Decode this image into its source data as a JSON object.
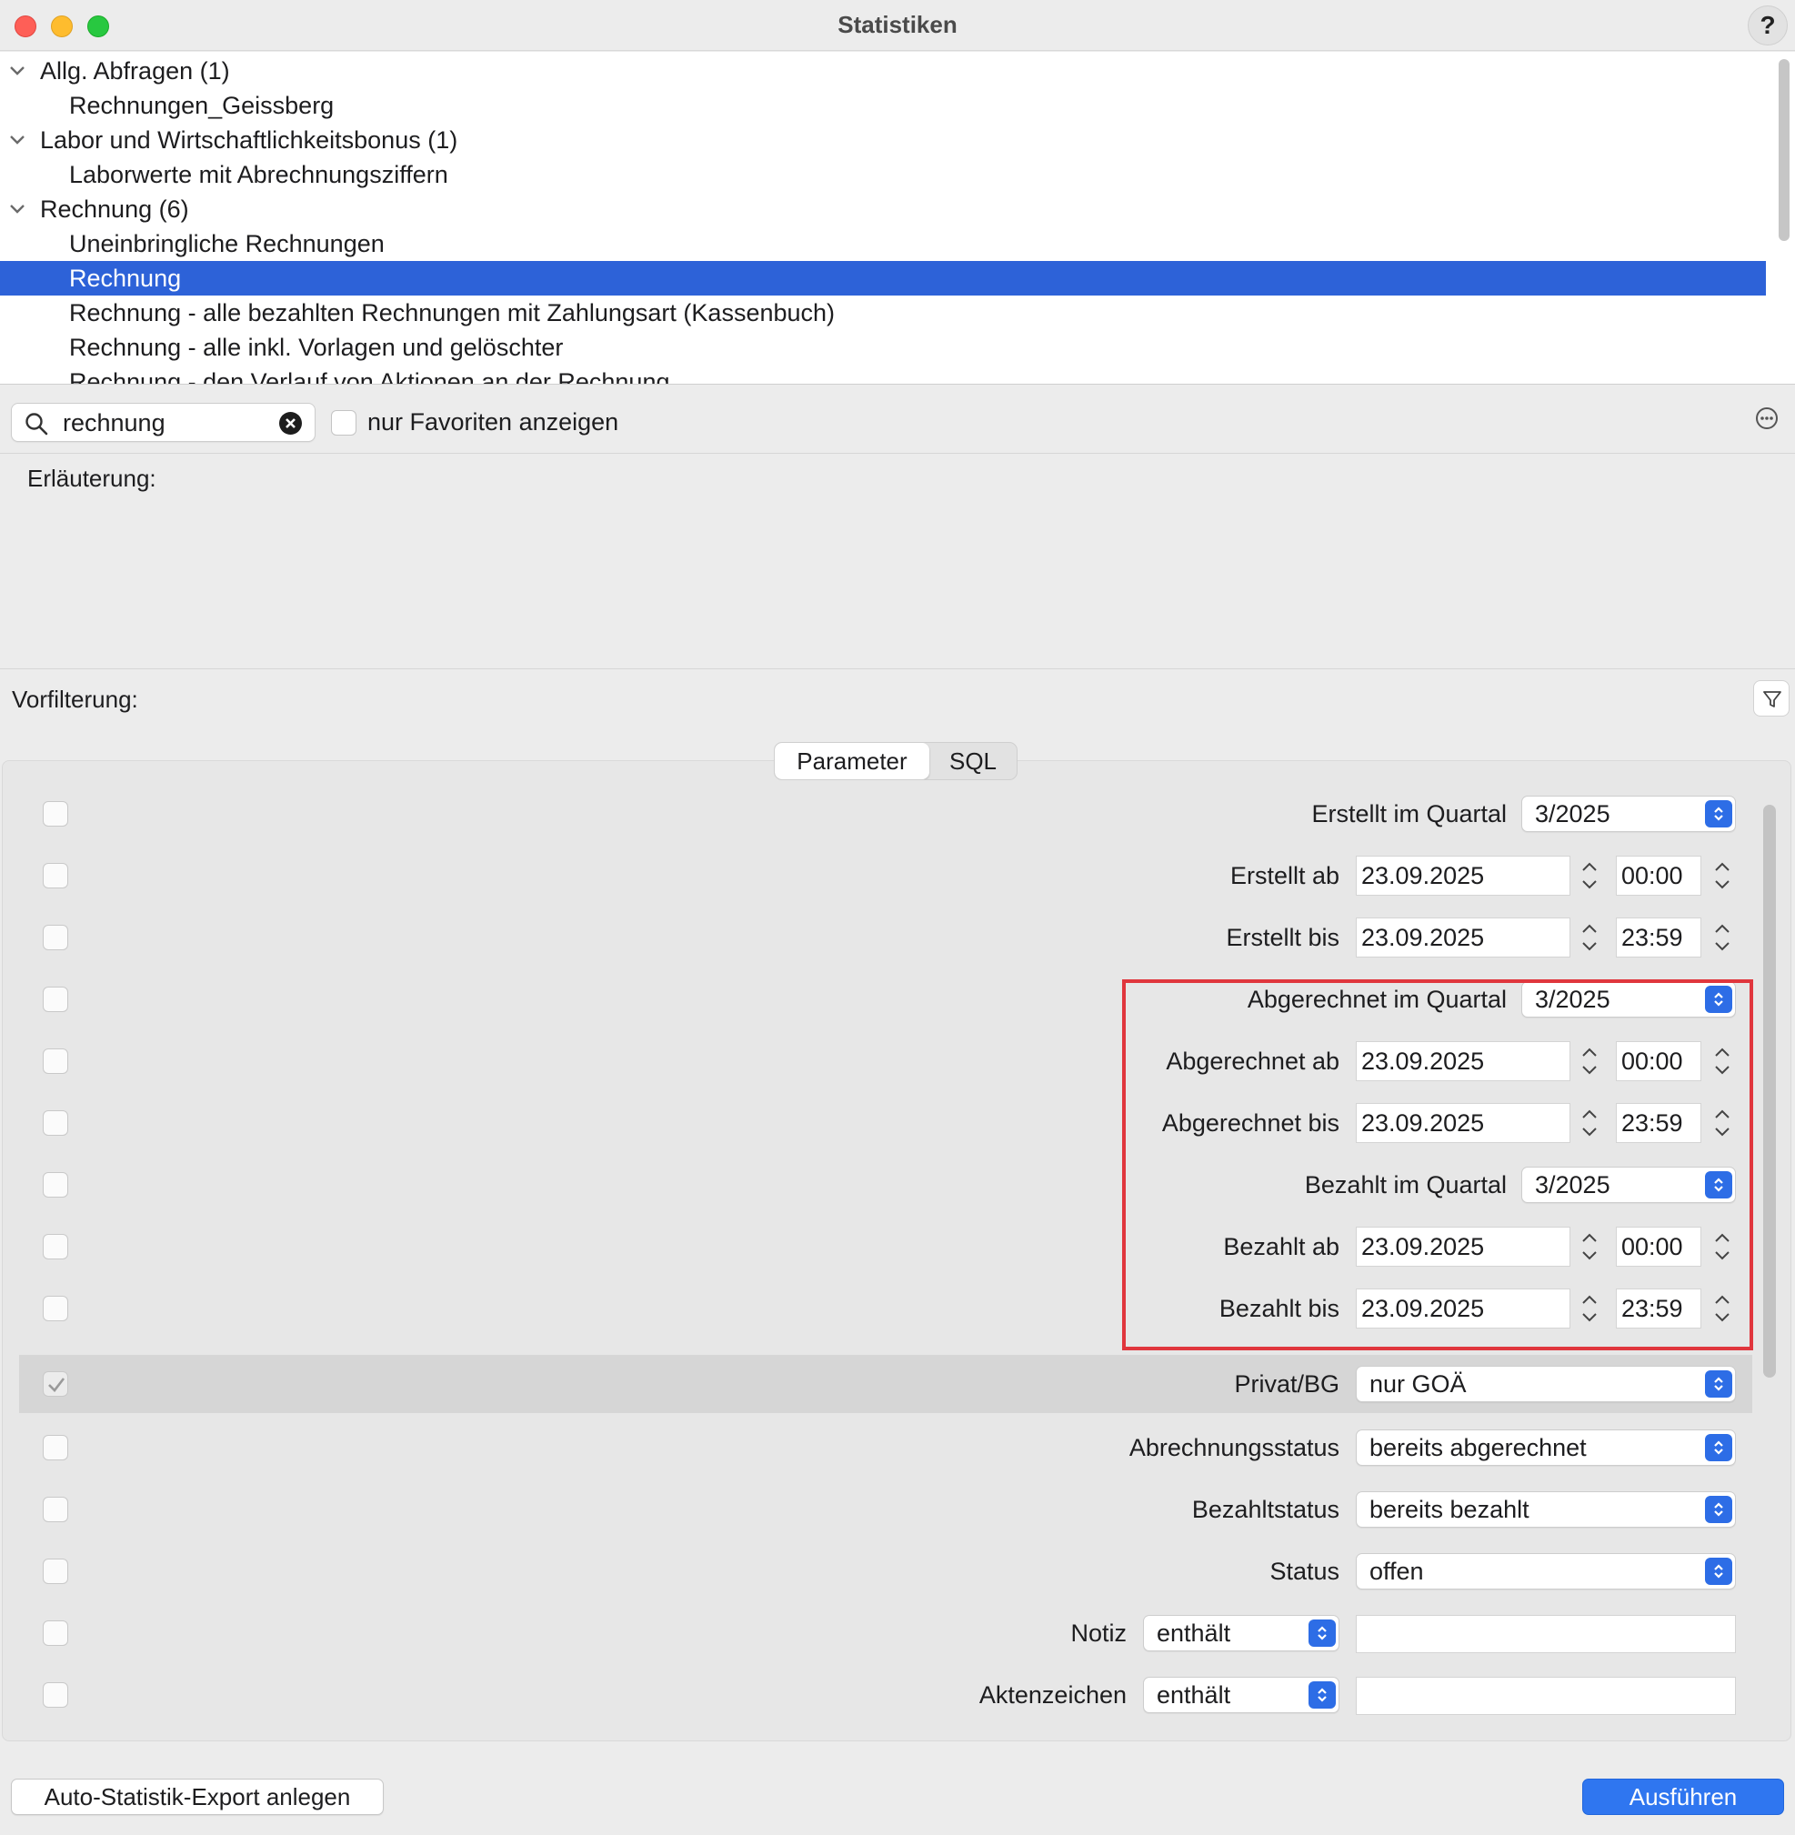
{
  "window": {
    "title": "Statistiken",
    "help_label": "?"
  },
  "tree": [
    {
      "label": "Allg. Abfragen (1)",
      "type": "group"
    },
    {
      "label": "Rechnungen_Geissberg",
      "type": "child"
    },
    {
      "label": "Labor und Wirtschaftlichkeitsbonus (1)",
      "type": "group"
    },
    {
      "label": "Laborwerte mit Abrechnungsziffern",
      "type": "child"
    },
    {
      "label": "Rechnung (6)",
      "type": "group"
    },
    {
      "label": "Uneinbringliche Rechnungen",
      "type": "child"
    },
    {
      "label": "Rechnung",
      "type": "child",
      "selected": true
    },
    {
      "label": "Rechnung - alle bezahlten Rechnungen mit Zahlungsart (Kassenbuch)",
      "type": "child"
    },
    {
      "label": "Rechnung - alle inkl. Vorlagen und gelöschter",
      "type": "child"
    },
    {
      "label": "Rechnung - den Verlauf von Aktionen an der Rechnung",
      "type": "child"
    }
  ],
  "search": {
    "value": "rechnung",
    "favorites_label": "nur Favoriten anzeigen"
  },
  "explanation_label": "Erläuterung:",
  "prefilter_label": "Vorfilterung:",
  "tabs": {
    "parameter": "Parameter",
    "sql": "SQL"
  },
  "params": {
    "erstellt_quartal": {
      "label": "Erstellt im Quartal",
      "value": "3/2025"
    },
    "erstellt_ab": {
      "label": "Erstellt ab",
      "date": "23.09.2025",
      "time": "00:00"
    },
    "erstellt_bis": {
      "label": "Erstellt bis",
      "date": "23.09.2025",
      "time": "23:59"
    },
    "abgerechnet_quartal": {
      "label": "Abgerechnet im Quartal",
      "value": "3/2025"
    },
    "abgerechnet_ab": {
      "label": "Abgerechnet ab",
      "date": "23.09.2025",
      "time": "00:00"
    },
    "abgerechnet_bis": {
      "label": "Abgerechnet bis",
      "date": "23.09.2025",
      "time": "23:59"
    },
    "bezahlt_quartal": {
      "label": "Bezahlt im Quartal",
      "value": "3/2025"
    },
    "bezahlt_ab": {
      "label": "Bezahlt ab",
      "date": "23.09.2025",
      "time": "00:00"
    },
    "bezahlt_bis": {
      "label": "Bezahlt bis",
      "date": "23.09.2025",
      "time": "23:59"
    },
    "privat_bg": {
      "label": "Privat/BG",
      "value": "nur GOÄ",
      "checked": true
    },
    "abrechnungsstatus": {
      "label": "Abrechnungsstatus",
      "value": "bereits abgerechnet"
    },
    "bezahltstatus": {
      "label": "Bezahltstatus",
      "value": "bereits bezahlt"
    },
    "status": {
      "label": "Status",
      "value": "offen"
    },
    "notiz": {
      "label": "Notiz",
      "operator": "enthält",
      "value": ""
    },
    "aktenzeichen": {
      "label": "Aktenzeichen",
      "operator": "enthält",
      "value": ""
    }
  },
  "buttons": {
    "export": "Auto-Statistik-Export anlegen",
    "run": "Ausführen"
  },
  "colors": {
    "selection": "#2d62d8",
    "accent": "#2f76f0",
    "highlight_box": "#e0363d"
  }
}
